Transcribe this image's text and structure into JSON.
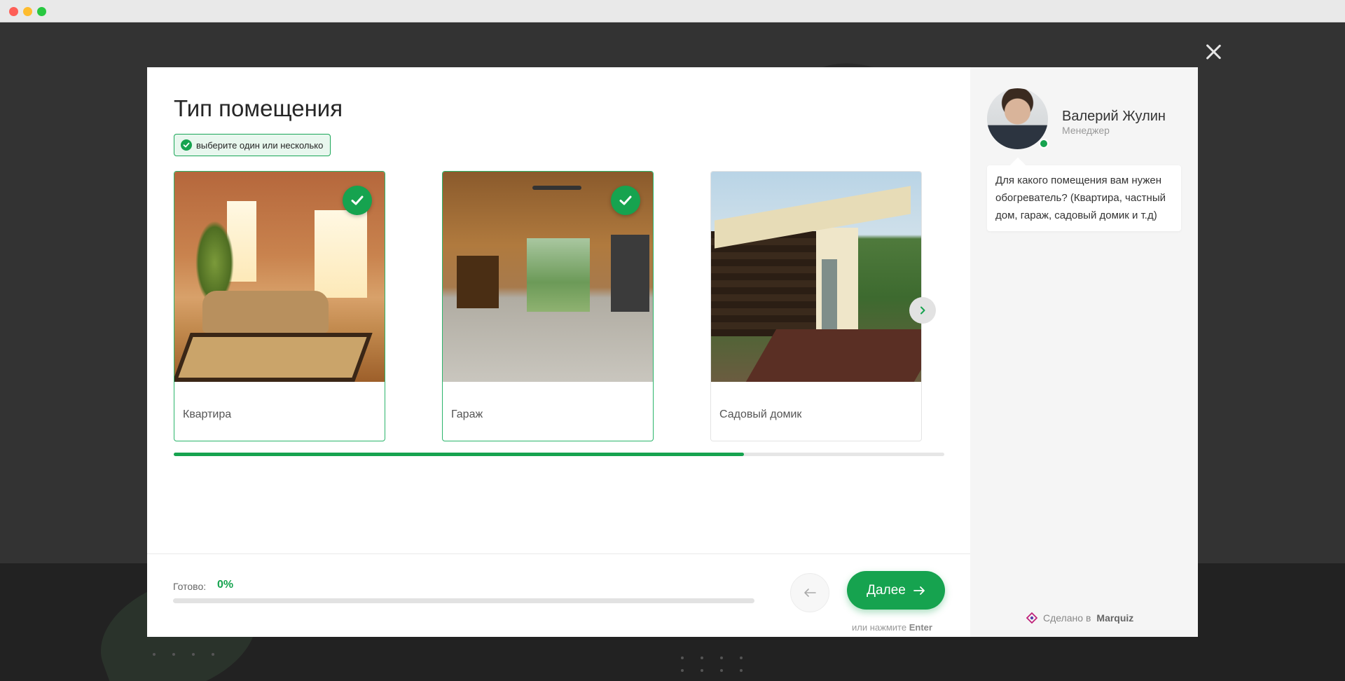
{
  "window": {
    "controls": [
      "close",
      "minimize",
      "zoom"
    ]
  },
  "quiz": {
    "question_title": "Тип помещения",
    "hint": "выберите один или несколько",
    "options": [
      {
        "label": "Квартира",
        "selected": true
      },
      {
        "label": "Гараж",
        "selected": true
      },
      {
        "label": "Садовый домик",
        "selected": false
      }
    ],
    "carousel_position": 0.74
  },
  "footer": {
    "progress_label": "Готово:",
    "progress_value": "0%",
    "progress": 0,
    "next_label": "Далее",
    "enter_hint_prefix": "или нажмите",
    "enter_hint_key": "Enter"
  },
  "manager": {
    "name": "Валерий Жулин",
    "role": "Менеджер",
    "online": true,
    "message": "Для какого помещения вам нужен обогреватель? (Квартира, частный дом, гараж, садовый домик и т.д)"
  },
  "branding": {
    "made_in_prefix": "Сделано в",
    "brand": "Marquiz"
  },
  "colors": {
    "accent": "#16a34f",
    "backdrop": "#333333",
    "side_panel": "#f5f5f5"
  }
}
